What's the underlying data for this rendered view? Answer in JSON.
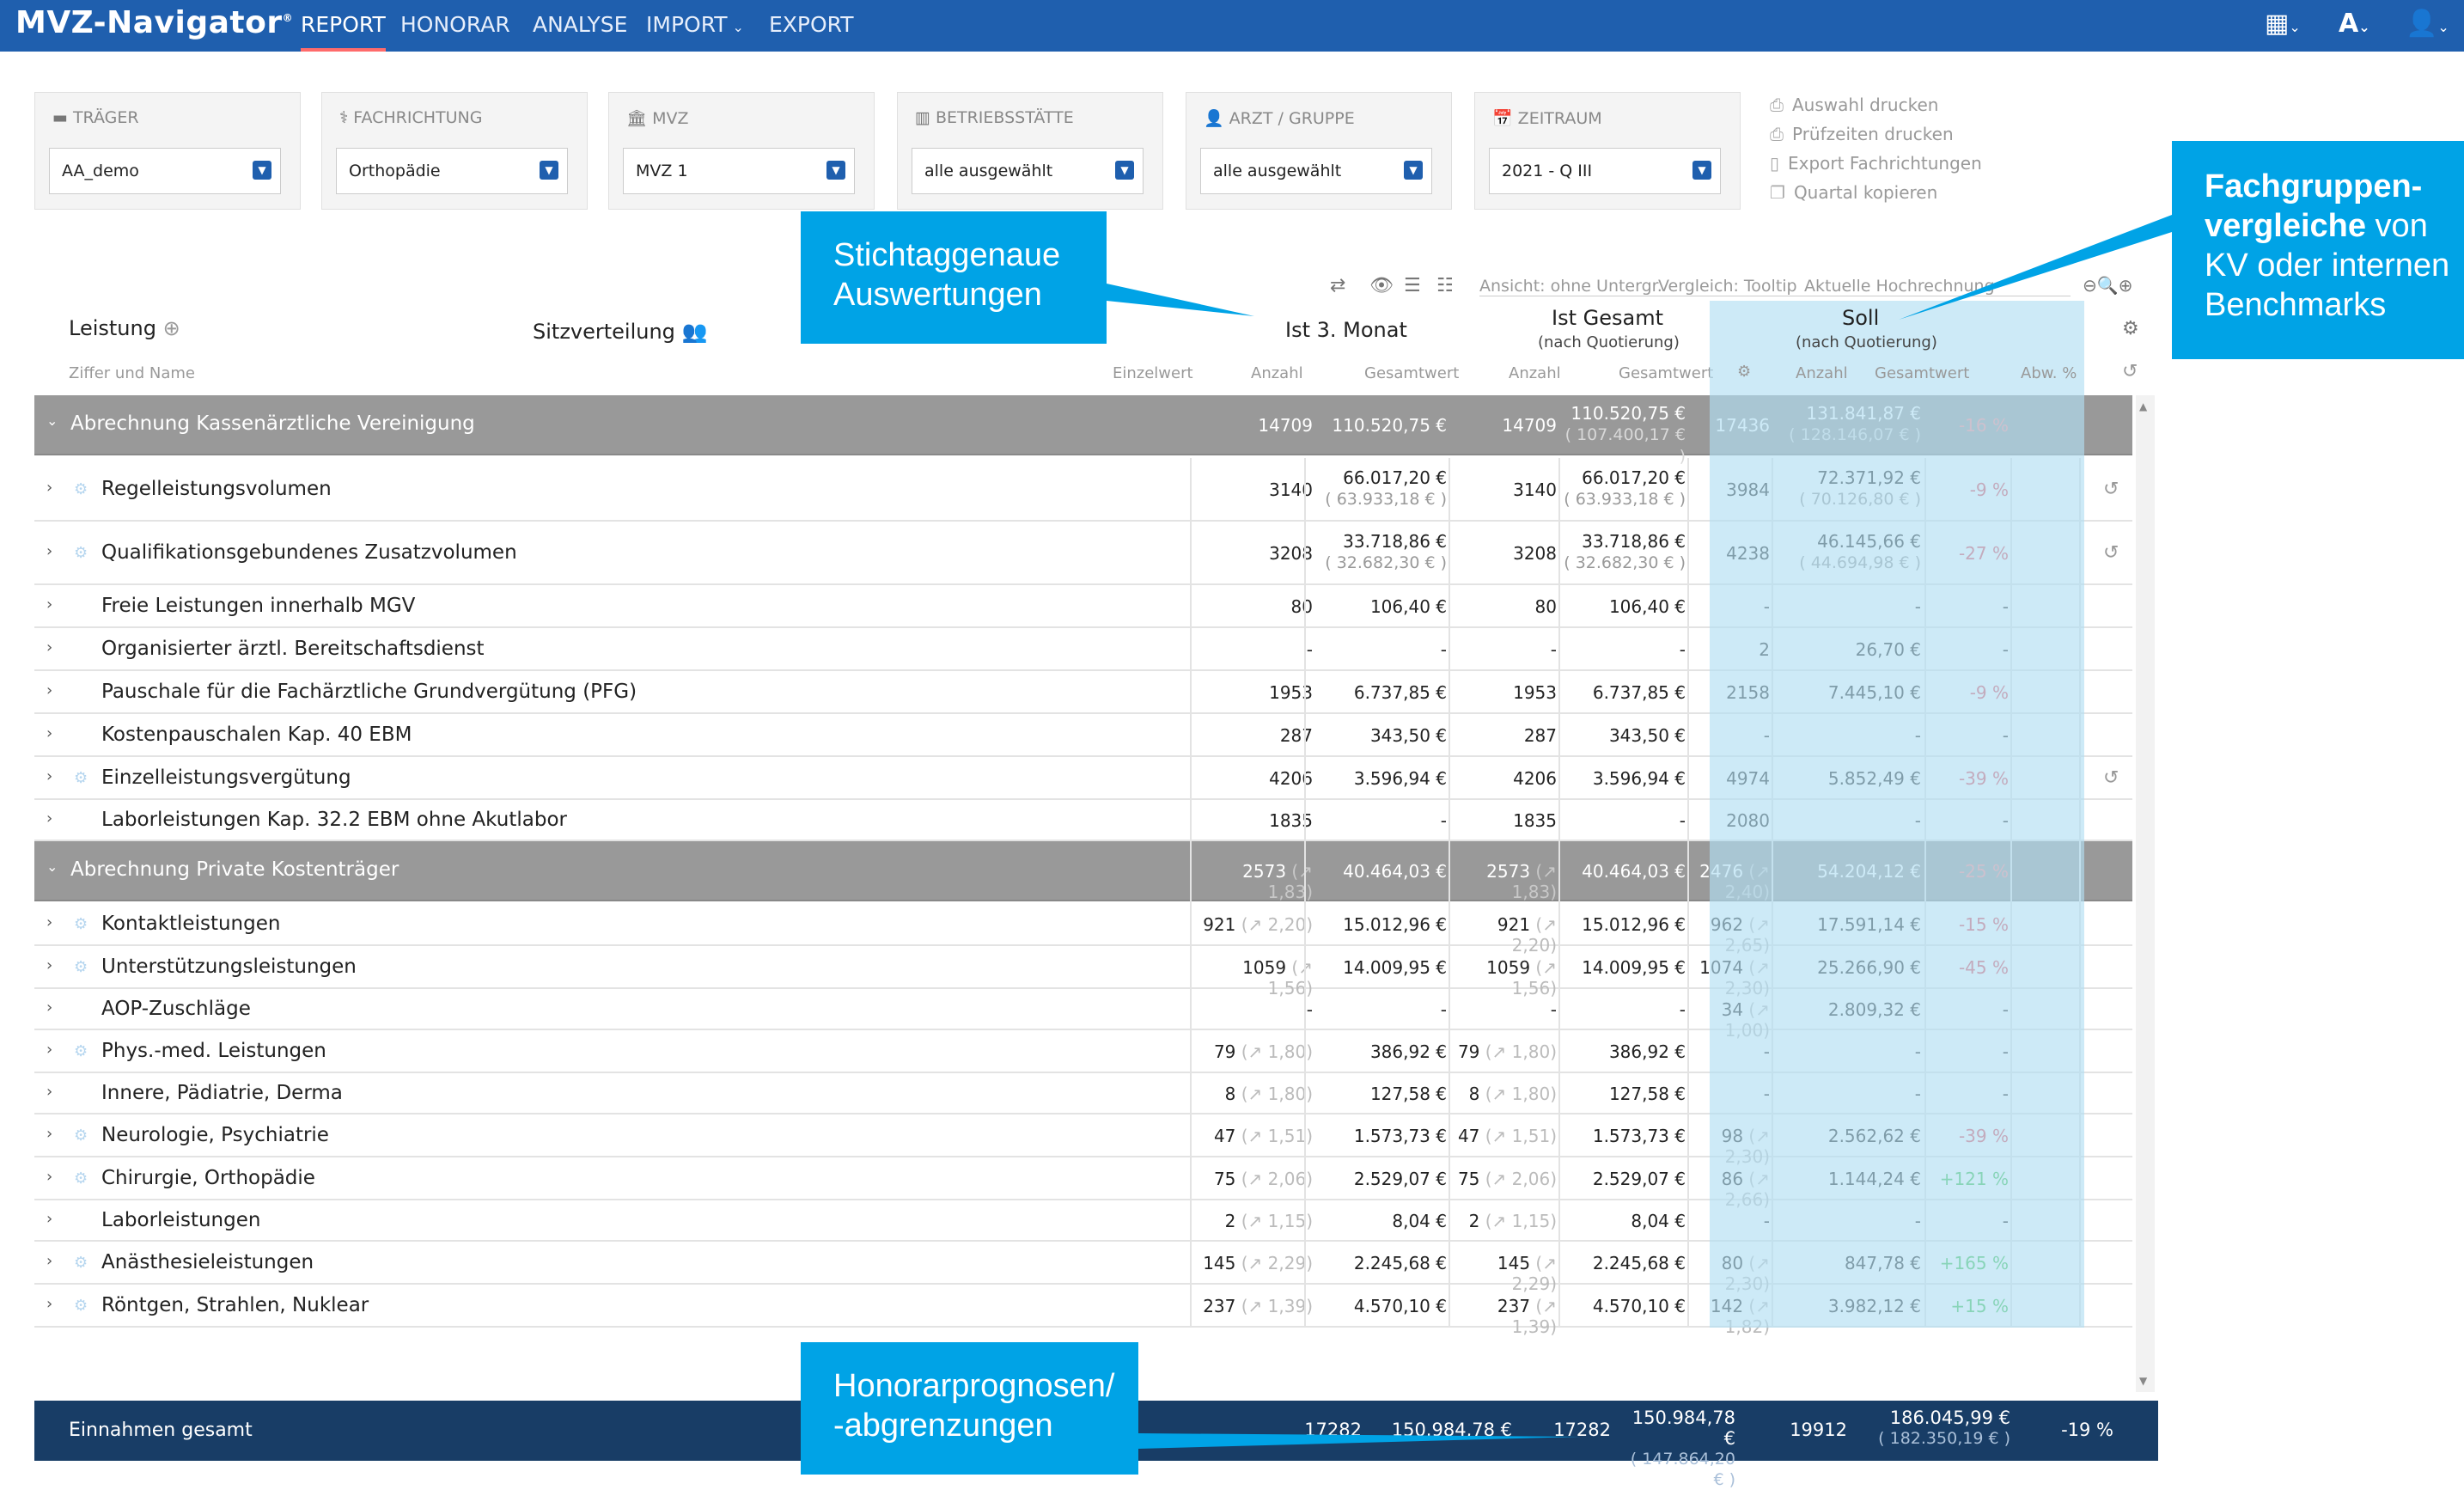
{
  "app": {
    "title": "MVZ-Navigator",
    "reg": "®"
  },
  "nav": [
    {
      "label": "REPORT"
    },
    {
      "label": "HONORAR"
    },
    {
      "label": "ANALYSE"
    },
    {
      "label": "IMPORT"
    },
    {
      "label": "EXPORT"
    }
  ],
  "colors": {
    "header": "#1f5fae",
    "accent": "#00a3e6",
    "group": "#999999",
    "footer": "#183d66",
    "neg": "#e14a5a",
    "pos": "#39c04a"
  },
  "filters": [
    {
      "label": "TRÄGER",
      "value": "AA_demo",
      "icon": "truck-icon"
    },
    {
      "label": "FACHRICHTUNG",
      "value": "Orthopädie",
      "icon": "stethoscope-icon"
    },
    {
      "label": "MVZ",
      "value": "MVZ 1",
      "icon": "building-icon"
    },
    {
      "label": "BETRIEBSSTÄTTE",
      "value": "alle ausgewählt",
      "icon": "clinic-icon"
    },
    {
      "label": "ARZT / GRUPPE",
      "value": "alle ausgewählt",
      "icon": "user-icon"
    },
    {
      "label": "ZEITRAUM",
      "value": "2021 - Q III",
      "icon": "calendar-icon"
    }
  ],
  "actions": [
    "Auswahl drucken",
    "Prüfzeiten drucken",
    "Export Fachrichtungen",
    "Quartal kopieren"
  ],
  "callouts": {
    "c1": [
      "Stichtaggenaue",
      "Auswertungen"
    ],
    "c2": {
      "bold1": "Fachgruppen-",
      "bold2": "vergleiche",
      "rest2": " von",
      "line3": "KV oder internen",
      "line4": "Benchmarks"
    },
    "c3": [
      "Honorarprognosen/",
      "-abgrenzungen"
    ]
  },
  "toolbar": {
    "view": "Ansicht: ohne Untergr.",
    "compare": "Vergleich: Tooltip",
    "forecast": "Aktuelle Hochrechnung"
  },
  "headers": {
    "leistung": "Leistung",
    "ziffer": "Ziffer und Name",
    "sitz": "Sitzverteilung",
    "ist3": "Ist 3. Monat",
    "istges": "Ist Gesamt",
    "soll": "Soll",
    "quot": "(nach Quotierung)",
    "einzel": "Einzelwert",
    "anzahl": "Anzahl",
    "gesamt": "Gesamtwert",
    "abw": "Abw. %"
  },
  "groups": [
    {
      "name": "Abrechnung Kassenärztliche Vereinigung",
      "a1": "14709",
      "g1": "110.520,75 €",
      "a2": "14709",
      "g2": "110.520,75 €",
      "g2q": "( 107.400,17 € )",
      "a3": "17436",
      "g3": "131.841,87 €",
      "g3q": "( 128.146,07 € )",
      "abw": "-16 %"
    },
    {
      "name": "Abrechnung Private Kostenträger",
      "a1": "2573",
      "a1f": "(↗ 1,83)",
      "g1": "40.464,03 €",
      "a2": "2573",
      "a2f": "(↗ 1,83)",
      "g2": "40.464,03 €",
      "a3": "2476",
      "a3f": "(↗ 2,40)",
      "g3": "54.204,12 €",
      "abw": "-25 %"
    }
  ],
  "rows": [
    {
      "name": "Regelleistungsvolumen",
      "gear": true,
      "a1": "3140",
      "g1": "66.017,20 €",
      "g1q": "( 63.933,18 € )",
      "a2": "3140",
      "g2": "66.017,20 €",
      "g2q": "( 63.933,18 € )",
      "a3": "3984",
      "g3": "72.371,92 €",
      "g3q": "( 70.126,80 € )",
      "abw": "-9 %",
      "hist": true
    },
    {
      "name": "Qualifikationsgebundenes Zusatzvolumen",
      "gear": true,
      "a1": "3208",
      "g1": "33.718,86 €",
      "g1q": "( 32.682,30 € )",
      "a2": "3208",
      "g2": "33.718,86 €",
      "g2q": "( 32.682,30 € )",
      "a3": "4238",
      "g3": "46.145,66 €",
      "g3q": "( 44.694,98 € )",
      "abw": "-27 %",
      "hist": true
    },
    {
      "name": "Freie Leistungen innerhalb MGV",
      "a1": "80",
      "g1": "106,40 €",
      "a2": "80",
      "g2": "106,40 €",
      "a3": "-",
      "g3": "-",
      "abw": "-"
    },
    {
      "name": "Organisierter ärztl. Bereitschaftsdienst",
      "a1": "-",
      "g1": "-",
      "a2": "-",
      "g2": "-",
      "a3": "2",
      "g3": "26,70 €",
      "abw": "-"
    },
    {
      "name": "Pauschale für die Fachärztliche Grundvergütung (PFG)",
      "a1": "1953",
      "g1": "6.737,85 €",
      "a2": "1953",
      "g2": "6.737,85 €",
      "a3": "2158",
      "g3": "7.445,10 €",
      "abw": "-9 %"
    },
    {
      "name": "Kostenpauschalen Kap. 40 EBM",
      "a1": "287",
      "g1": "343,50 €",
      "a2": "287",
      "g2": "343,50 €",
      "a3": "-",
      "g3": "-",
      "abw": "-"
    },
    {
      "name": "Einzelleistungsvergütung",
      "gear": true,
      "a1": "4206",
      "g1": "3.596,94 €",
      "a2": "4206",
      "g2": "3.596,94 €",
      "a3": "4974",
      "g3": "5.852,49 €",
      "abw": "-39 %",
      "hist": true
    },
    {
      "name": "Laborleistungen Kap. 32.2 EBM ohne Akutlabor",
      "a1": "1835",
      "g1": "-",
      "a2": "1835",
      "g2": "-",
      "a3": "2080",
      "g3": "-",
      "abw": "-"
    },
    {
      "name": "Kontaktleistungen",
      "gear": true,
      "a1": "921",
      "a1f": "(↗ 2,20)",
      "g1": "15.012,96 €",
      "a2": "921",
      "a2f": "(↗ 2,20)",
      "g2": "15.012,96 €",
      "a3": "962",
      "a3f": "(↗ 2,65)",
      "g3": "17.591,14 €",
      "abw": "-15 %"
    },
    {
      "name": "Unterstützungsleistungen",
      "gear": true,
      "a1": "1059",
      "a1f": "(↗ 1,56)",
      "g1": "14.009,95 €",
      "a2": "1059",
      "a2f": "(↗ 1,56)",
      "g2": "14.009,95 €",
      "a3": "1074",
      "a3f": "(↗ 2,30)",
      "g3": "25.266,90 €",
      "abw": "-45 %"
    },
    {
      "name": "AOP-Zuschläge",
      "a1": "-",
      "g1": "-",
      "a2": "-",
      "g2": "-",
      "a3": "34",
      "a3f": "(↗ 1,00)",
      "g3": "2.809,32 €",
      "abw": "-"
    },
    {
      "name": "Phys.-med. Leistungen",
      "gear": true,
      "a1": "79",
      "a1f": "(↗ 1,80)",
      "g1": "386,92 €",
      "a2": "79",
      "a2f": "(↗ 1,80)",
      "g2": "386,92 €",
      "a3": "-",
      "g3": "-",
      "abw": "-"
    },
    {
      "name": "Innere, Pädiatrie, Derma",
      "a1": "8",
      "a1f": "(↗ 1,80)",
      "g1": "127,58 €",
      "a2": "8",
      "a2f": "(↗ 1,80)",
      "g2": "127,58 €",
      "a3": "-",
      "g3": "-",
      "abw": "-"
    },
    {
      "name": "Neurologie, Psychiatrie",
      "gear": true,
      "a1": "47",
      "a1f": "(↗ 1,51)",
      "g1": "1.573,73 €",
      "a2": "47",
      "a2f": "(↗ 1,51)",
      "g2": "1.573,73 €",
      "a3": "98",
      "a3f": "(↗ 2,30)",
      "g3": "2.562,62 €",
      "abw": "-39 %"
    },
    {
      "name": "Chirurgie, Orthopädie",
      "gear": true,
      "a1": "75",
      "a1f": "(↗ 2,06)",
      "g1": "2.529,07 €",
      "a2": "75",
      "a2f": "(↗ 2,06)",
      "g2": "2.529,07 €",
      "a3": "86",
      "a3f": "(↗ 2,66)",
      "g3": "1.144,24 €",
      "abw": "+121 %"
    },
    {
      "name": "Laborleistungen",
      "a1": "2",
      "a1f": "(↗ 1,15)",
      "g1": "8,04 €",
      "a2": "2",
      "a2f": "(↗ 1,15)",
      "g2": "8,04 €",
      "a3": "-",
      "g3": "-",
      "abw": "-"
    },
    {
      "name": "Anästhesieleistungen",
      "gear": true,
      "a1": "145",
      "a1f": "(↗ 2,29)",
      "g1": "2.245,68 €",
      "a2": "145",
      "a2f": "(↗ 2,29)",
      "g2": "2.245,68 €",
      "a3": "80",
      "a3f": "(↗ 2,30)",
      "g3": "847,78 €",
      "abw": "+165 %"
    },
    {
      "name": "Röntgen, Strahlen, Nuklear",
      "gear": true,
      "a1": "237",
      "a1f": "(↗ 1,39)",
      "g1": "4.570,10 €",
      "a2": "237",
      "a2f": "(↗ 1,39)",
      "g2": "4.570,10 €",
      "a3": "142",
      "a3f": "(↗ 1,82)",
      "g3": "3.982,12 €",
      "abw": "+15 %"
    }
  ],
  "footer": {
    "label": "Einnahmen gesamt",
    "a1": "17282",
    "g1": "150.984,78 €",
    "a2": "17282",
    "g2": "150.984,78 €",
    "g2q": "( 147.864,20 € )",
    "a3": "19912",
    "g3": "186.045,99 €",
    "g3q": "( 182.350,19 € )",
    "abw": "-19 %"
  }
}
